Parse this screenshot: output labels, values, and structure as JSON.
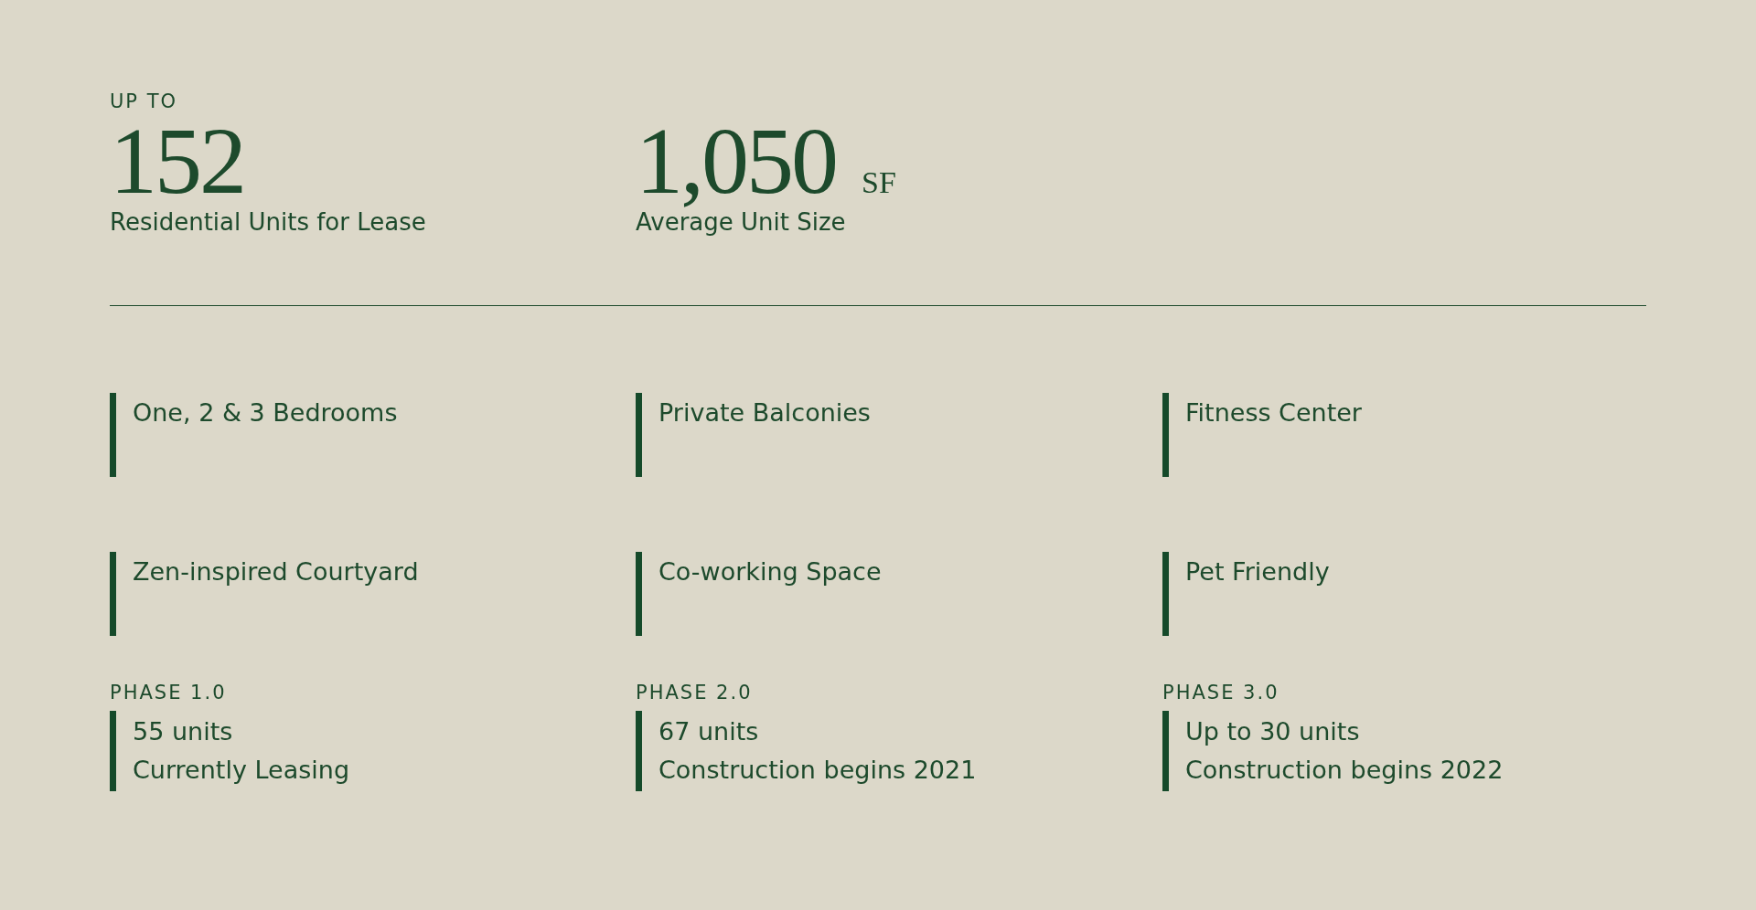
{
  "stats": [
    {
      "prefix": "UP TO",
      "value": "152",
      "caption": "Residential Units for Lease"
    },
    {
      "value": "1,050",
      "unit": "SF",
      "caption": "Average Unit Size"
    }
  ],
  "features": [
    "One, 2 & 3 Bedrooms",
    "Private Balconies",
    "Fitness Center",
    "Zen-inspired Courtyard",
    "Co-working Space",
    "Pet Friendly"
  ],
  "phases": [
    {
      "label": "PHASE 1.0",
      "lines": [
        "55 units",
        "Currently Leasing"
      ]
    },
    {
      "label": "PHASE 2.0",
      "lines": [
        "67 units",
        "Construction begins 2021"
      ]
    },
    {
      "label": "PHASE 3.0",
      "lines": [
        "Up to 30 units",
        "Construction begins 2022"
      ]
    }
  ]
}
